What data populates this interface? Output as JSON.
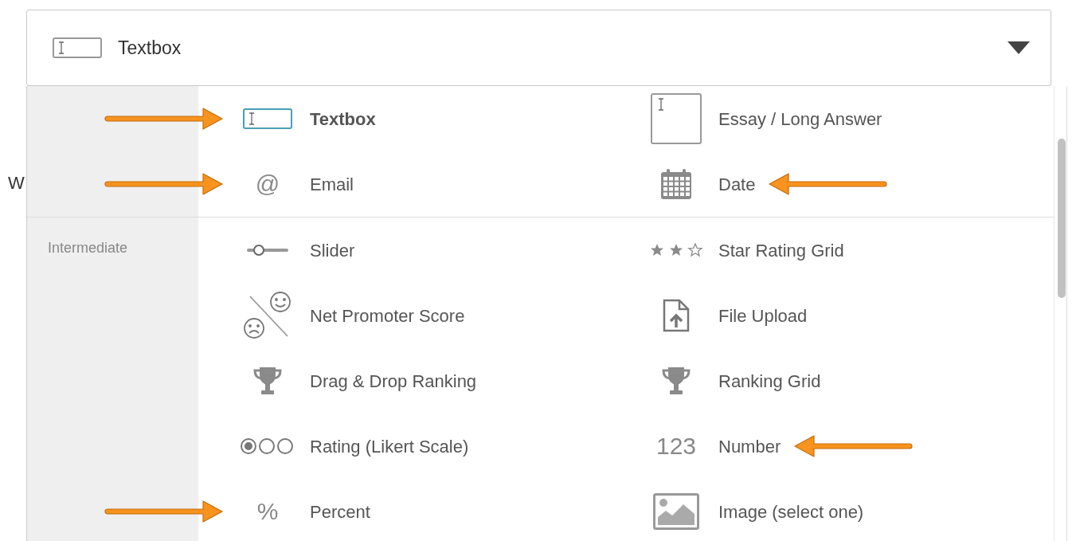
{
  "background_text": "W",
  "select": {
    "value": "Textbox",
    "kind": "textbox"
  },
  "groups": [
    {
      "items": [
        {
          "label": "Textbox",
          "kind": "textbox",
          "selected": true,
          "pointed": true
        },
        {
          "label": "Essay / Long Answer",
          "kind": "essay",
          "selected": false,
          "pointed": false
        },
        {
          "label": "Email",
          "kind": "glyph",
          "icon_text": "@",
          "selected": false,
          "pointed": true
        },
        {
          "label": "Date",
          "kind": "date",
          "selected": false,
          "pointed": true
        }
      ]
    },
    {
      "label": "Intermediate",
      "items": [
        {
          "label": "Slider",
          "kind": "slider",
          "selected": false,
          "pointed": false
        },
        {
          "label": "Star Rating Grid",
          "kind": "stars",
          "selected": false,
          "pointed": false
        },
        {
          "label": "Net Promoter Score",
          "kind": "nps",
          "selected": false,
          "pointed": false
        },
        {
          "label": "File Upload",
          "kind": "upload",
          "selected": false,
          "pointed": false
        },
        {
          "label": "Drag & Drop Ranking",
          "kind": "trophy",
          "selected": false,
          "pointed": false
        },
        {
          "label": "Ranking Grid",
          "kind": "trophy",
          "selected": false,
          "pointed": false
        },
        {
          "label": "Rating (Likert Scale)",
          "kind": "likert",
          "selected": false,
          "pointed": false
        },
        {
          "label": "Number",
          "kind": "glyph",
          "icon_text": "123",
          "selected": false,
          "pointed": true
        },
        {
          "label": "Percent",
          "kind": "glyph",
          "icon_text": "%",
          "selected": false,
          "pointed": true
        },
        {
          "label": "Image (select one)",
          "kind": "image",
          "selected": false,
          "pointed": false
        }
      ]
    }
  ]
}
